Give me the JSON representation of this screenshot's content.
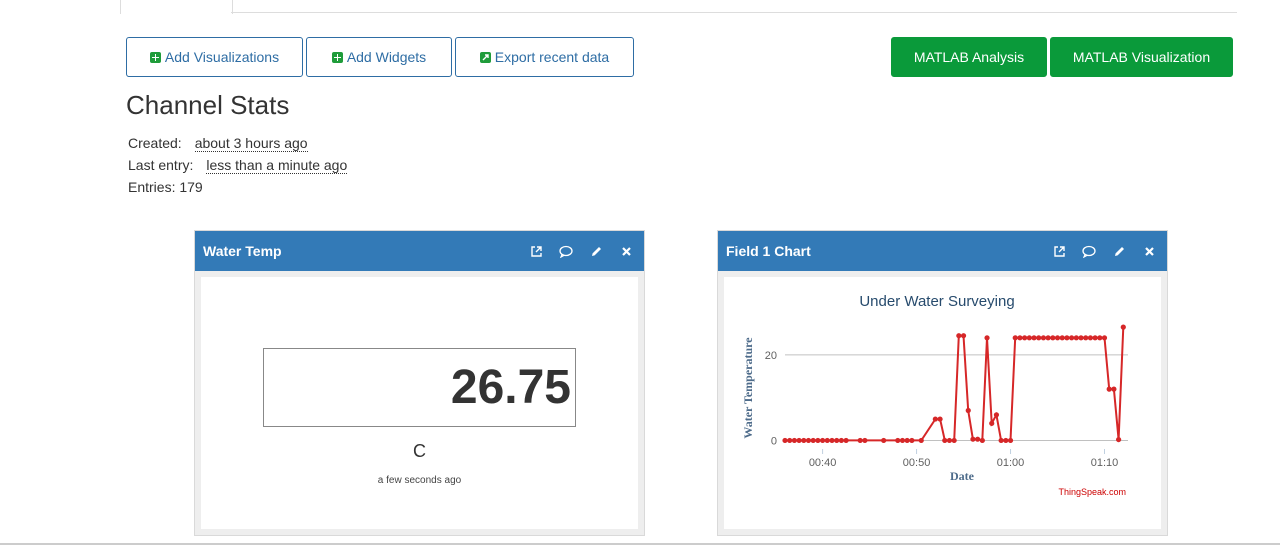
{
  "toolbar": {
    "add_visualizations": "Add Visualizations",
    "add_widgets": "Add Widgets",
    "export_recent_data": "Export recent data",
    "matlab_analysis": "MATLAB Analysis",
    "matlab_visualization": "MATLAB Visualization"
  },
  "stats": {
    "title": "Channel Stats",
    "created_label": "Created:",
    "created_value": "about 3 hours ago",
    "last_entry_label": "Last entry:",
    "last_entry_value": "less than a minute ago",
    "entries_label": "Entries: 179"
  },
  "widget_temp": {
    "title": "Water Temp",
    "value": "26.75",
    "unit": "C",
    "updated": "a few seconds ago"
  },
  "widget_chart": {
    "title": "Field 1 Chart",
    "credit": "ThingSpeak.com"
  },
  "colors": {
    "header_blue": "#337ab7",
    "green": "#0a9a3a",
    "line_red": "#d62728"
  },
  "chart_data": {
    "type": "line",
    "title": "Under Water Surveying",
    "xlabel": "Date",
    "ylabel": "Water Temperature",
    "x_ticks": [
      "00:40",
      "00:50",
      "01:00",
      "01:10"
    ],
    "y_ticks": [
      0,
      20
    ],
    "xlim": [
      "00:36:00",
      "01:12:30"
    ],
    "ylim": [
      -2,
      27
    ],
    "grid": true,
    "x": [
      "00:36:00",
      "00:36:30",
      "00:37:00",
      "00:37:30",
      "00:38:00",
      "00:38:30",
      "00:39:00",
      "00:39:30",
      "00:40:00",
      "00:40:30",
      "00:41:00",
      "00:41:30",
      "00:42:00",
      "00:42:30",
      "00:44:00",
      "00:44:30",
      "00:46:30",
      "00:48:00",
      "00:48:30",
      "00:49:00",
      "00:49:30",
      "00:50:30",
      "00:52:00",
      "00:52:30",
      "00:53:00",
      "00:53:30",
      "00:54:00",
      "00:54:30",
      "00:55:00",
      "00:55:30",
      "00:56:00",
      "00:56:30",
      "00:57:00",
      "00:57:30",
      "00:58:00",
      "00:58:30",
      "00:59:00",
      "00:59:30",
      "01:00:00",
      "01:00:30",
      "01:01:00",
      "01:01:30",
      "01:02:00",
      "01:02:30",
      "01:03:00",
      "01:03:30",
      "01:04:00",
      "01:04:30",
      "01:05:00",
      "01:05:30",
      "01:06:00",
      "01:06:30",
      "01:07:00",
      "01:07:30",
      "01:08:00",
      "01:08:30",
      "01:09:00",
      "01:09:30",
      "01:10:00",
      "01:10:30",
      "01:11:00",
      "01:11:30",
      "01:12:00"
    ],
    "y": [
      0,
      0,
      0,
      0,
      0,
      0,
      0,
      0,
      0,
      0,
      0,
      0,
      0,
      0,
      0,
      0,
      0,
      0,
      0,
      0,
      0,
      0,
      5,
      5,
      0,
      0,
      0,
      24.5,
      24.5,
      7,
      0.3,
      0.3,
      0,
      24,
      4,
      6,
      0,
      0,
      0,
      24,
      24,
      24,
      24,
      24,
      24,
      24,
      24,
      24,
      24,
      24,
      24,
      24,
      24,
      24,
      24,
      24,
      24,
      24,
      24,
      12,
      12,
      0.2,
      26.5
    ]
  }
}
